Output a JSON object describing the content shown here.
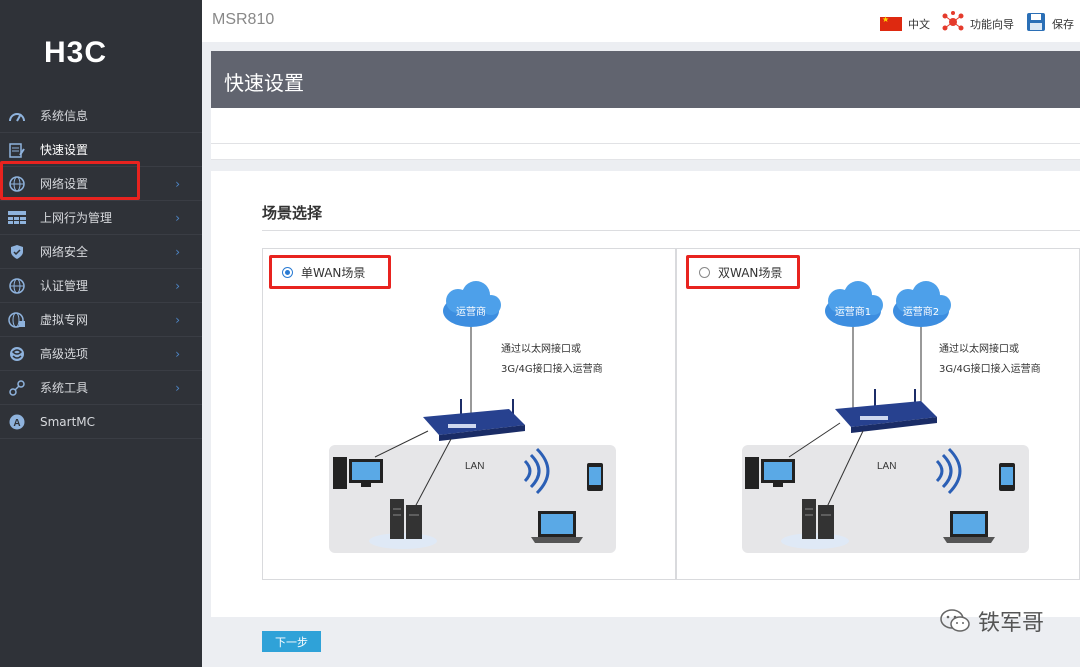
{
  "brand": {
    "logo_text": "H3C",
    "model": "MSR810"
  },
  "topbar": {
    "language_label": "中文",
    "wizard_label": "功能向导",
    "save_label": "保存"
  },
  "sidebar": {
    "items": [
      {
        "label": "系统信息",
        "icon": "gauge-icon",
        "has_chevron": false
      },
      {
        "label": "快速设置",
        "icon": "quick-setup-icon",
        "has_chevron": false,
        "active": true
      },
      {
        "label": "网络设置",
        "icon": "globe-icon",
        "has_chevron": true
      },
      {
        "label": "上网行为管理",
        "icon": "grid-icon",
        "has_chevron": true
      },
      {
        "label": "网络安全",
        "icon": "shield-icon",
        "has_chevron": true
      },
      {
        "label": "认证管理",
        "icon": "globe-icon",
        "has_chevron": true
      },
      {
        "label": "虚拟专网",
        "icon": "vpn-globe-icon",
        "has_chevron": true
      },
      {
        "label": "高级选项",
        "icon": "advanced-icon",
        "has_chevron": true
      },
      {
        "label": "系统工具",
        "icon": "tools-icon",
        "has_chevron": true
      },
      {
        "label": "SmartMC",
        "icon": "smartmc-icon",
        "has_chevron": false
      }
    ]
  },
  "page": {
    "title": "快速设置",
    "section_title": "场景选择",
    "scenarios": [
      {
        "label": "单WAN场景",
        "checked": true,
        "clouds": [
          "运营商"
        ],
        "desc_line1": "通过以太网接口或",
        "desc_line2": "3G/4G接口接入运营商",
        "lan_label": "LAN"
      },
      {
        "label": "双WAN场景",
        "checked": false,
        "clouds": [
          "运营商1",
          "运营商2"
        ],
        "desc_line1": "通过以太网接口或",
        "desc_line2": "3G/4G接口接入运营商",
        "lan_label": "LAN"
      }
    ],
    "next_button": "下一步"
  },
  "watermark": {
    "text": "铁军哥"
  },
  "colors": {
    "accent": "#2fa2d8",
    "highlight": "#e8231f",
    "sidebar": "#2f3238",
    "header": "#61646f"
  }
}
